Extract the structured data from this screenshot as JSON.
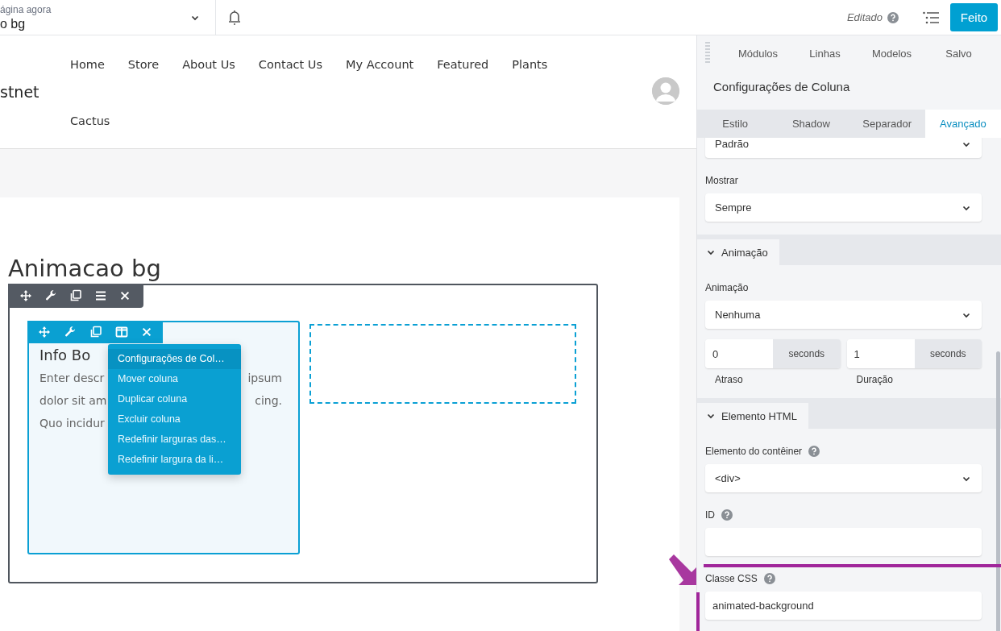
{
  "topbar": {
    "page_label": "ágina agora",
    "page_name": "o bg",
    "status": "Editado",
    "done_button": "Feito"
  },
  "site": {
    "logo": "stnet",
    "nav_rows": [
      [
        "Home",
        "Store",
        "About Us",
        "Contact Us",
        "My Account",
        "Featured",
        "Plants"
      ],
      [
        "Cactus"
      ]
    ]
  },
  "page": {
    "title": "Animacao bg"
  },
  "column": {
    "heading": "Info Bo",
    "lines": [
      {
        "left": "Enter descr",
        "right": "ipsum"
      },
      {
        "left": "dolor sit am",
        "right": "cing."
      },
      {
        "left": "Quo incidur"
      }
    ]
  },
  "context_menu": [
    {
      "label": "Configurações de Col…",
      "selected": true
    },
    {
      "label": "Mover coluna",
      "selected": false
    },
    {
      "label": "Duplicar coluna",
      "selected": false
    },
    {
      "label": "Excluir coluna",
      "selected": false
    },
    {
      "label": "Redefinir larguras das…",
      "selected": false
    },
    {
      "label": "Redefinir largura da li…",
      "selected": false
    }
  ],
  "panel": {
    "tabs": [
      "Módulos",
      "Linhas",
      "Modelos",
      "Salvo"
    ],
    "title": "Configurações de Coluna",
    "setting_tabs": [
      {
        "label": "Estilo",
        "selected": false
      },
      {
        "label": "Shadow",
        "selected": false
      },
      {
        "label": "Separador",
        "selected": false
      },
      {
        "label": "Avançado",
        "selected": true
      }
    ],
    "content": [
      {
        "kind": "select",
        "value": "Padrão"
      },
      {
        "kind": "select",
        "label": "Mostrar",
        "value": "Sempre"
      },
      {
        "kind": "section",
        "label": "Animação",
        "expanded": true
      },
      {
        "kind": "select",
        "label": "Animação",
        "value": "Nenhuma"
      },
      {
        "kind": "durations",
        "items": [
          {
            "value": "0",
            "unit": "seconds",
            "label": "Atraso"
          },
          {
            "value": "1",
            "unit": "seconds",
            "label": "Duração"
          }
        ]
      },
      {
        "kind": "section",
        "label": "Elemento HTML",
        "expanded": true
      },
      {
        "kind": "select",
        "label": "Elemento do contêiner",
        "help": true,
        "value": "<div>"
      },
      {
        "kind": "input",
        "label": "ID",
        "help": true
      },
      {
        "kind": "input",
        "label": "Classe CSS",
        "help": true,
        "value": "animated-background"
      }
    ]
  }
}
